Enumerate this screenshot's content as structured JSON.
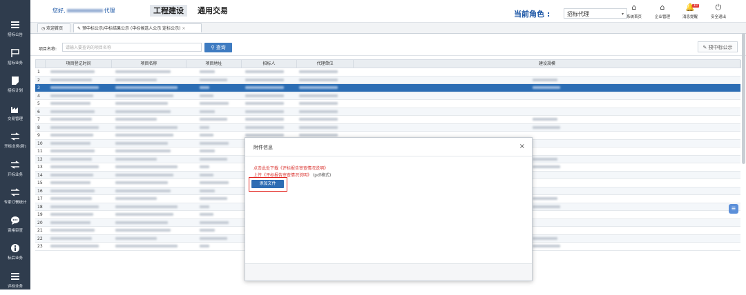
{
  "sidebar": {
    "items": [
      {
        "label": "招标公告",
        "icon": "menu-icon"
      },
      {
        "label": "招标业务",
        "icon": "flag-icon"
      },
      {
        "label": "招标计划",
        "icon": "note-icon"
      },
      {
        "label": "交易管理",
        "icon": "factory-icon"
      },
      {
        "label": "开标业务(新)",
        "icon": "exchange-icon"
      },
      {
        "label": "开标业务",
        "icon": "exchange-icon"
      },
      {
        "label": "专家订餐统计",
        "icon": "exchange-icon"
      },
      {
        "label": "资格审查",
        "icon": "chat-icon"
      },
      {
        "label": "标后业务",
        "icon": "info-icon"
      },
      {
        "label": "评标业务",
        "icon": "menu-icon"
      }
    ]
  },
  "header": {
    "greeting_prefix": "您好,",
    "greeting_suffix": "代理",
    "system_tabs": [
      {
        "label": "工程建设",
        "active": true
      },
      {
        "label": "通用交易",
        "active": false
      }
    ],
    "role_label": "当前角色 :",
    "role_value": "招标代理",
    "tools": [
      {
        "label": "系统首页",
        "icon": "home-icon",
        "glyph": "⌂"
      },
      {
        "label": "企业管理",
        "icon": "home-icon",
        "glyph": "⌂"
      },
      {
        "label": "消息提醒",
        "icon": "bell-icon",
        "glyph": "🔔",
        "badge": "10"
      },
      {
        "label": "安全退出",
        "icon": "power-icon",
        "glyph": "⏻"
      }
    ]
  },
  "tabs": [
    {
      "label": "欢迎首页",
      "active": false
    },
    {
      "label": "预中标公示/中标结果公示 (中标候选人公示 定标公示)",
      "active": true
    }
  ],
  "search": {
    "label": "项目名称:",
    "placeholder": "请输入要查询的项目名称",
    "button_label": "查询",
    "publish_label": "预中标公示"
  },
  "table": {
    "columns": [
      "",
      "项目登记时间",
      "项目名称",
      "项目地址",
      "招标人",
      "代理单位",
      "建设规模"
    ],
    "row_numbers": [
      "1",
      "2",
      "3",
      "4",
      "5",
      "6",
      "7",
      "8",
      "9",
      "10",
      "11",
      "12",
      "13",
      "14",
      "15",
      "16",
      "17",
      "18",
      "19",
      "20",
      "21",
      "22",
      "23"
    ],
    "selected_row": 3
  },
  "modal": {
    "title": "附件信息",
    "close": "×",
    "download_line": "点击此处下载《评标报告审查情况说明》",
    "upload_line": "上传《评标报告审查情况说明》",
    "upload_tip": "(pdf格式)",
    "add_button": "添加文件"
  },
  "colors": {
    "sidebar_bg": "#2f3c4d",
    "primary": "#2b6db4",
    "accent_red": "#e2211c"
  }
}
